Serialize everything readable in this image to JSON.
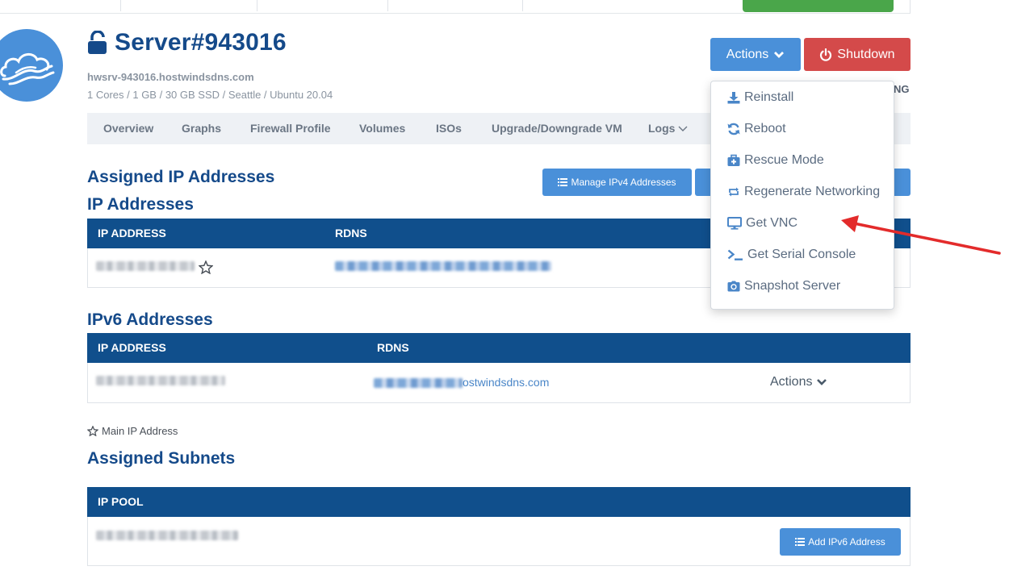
{
  "server": {
    "title": "Server#943016",
    "hostname": "hwsrv-943016.hostwindsdns.com",
    "specs": "1 Cores / 1 GB / 30 GB SSD / Seattle / Ubuntu 20.04",
    "status_fragment": "NG"
  },
  "header_buttons": {
    "actions_label": "Actions",
    "shutdown_label": "Shutdown"
  },
  "tabs": [
    {
      "label": "Overview"
    },
    {
      "label": "Graphs"
    },
    {
      "label": "Firewall Profile"
    },
    {
      "label": "Volumes"
    },
    {
      "label": "ISOs"
    },
    {
      "label": "Upgrade/Downgrade VM"
    },
    {
      "label": "Logs"
    }
  ],
  "assigned_ip": {
    "heading": "Assigned IP Addresses",
    "manage_ipv4_label": "Manage IPv4 Addresses"
  },
  "ipv4": {
    "heading": "IP Addresses",
    "columns": [
      "IP ADDRESS",
      "RDNS"
    ]
  },
  "ipv6": {
    "heading": "IPv6 Addresses",
    "columns": [
      "IP ADDRESS",
      "RDNS"
    ],
    "rdns_visible": "ostwindsdns.com",
    "row_actions_label": "Actions"
  },
  "main_ip_note": "Main IP Address",
  "subnets": {
    "heading": "Assigned Subnets",
    "columns": [
      "IP POOL"
    ],
    "add_ipv6_label": "Add IPv6 Address"
  },
  "dropdown": {
    "items": [
      {
        "label": "Reinstall",
        "icon": "download-icon"
      },
      {
        "label": "Reboot",
        "icon": "refresh-icon"
      },
      {
        "label": "Rescue Mode",
        "icon": "medkit-icon"
      },
      {
        "label": "Regenerate Networking",
        "icon": "retweet-icon"
      },
      {
        "label": "Get VNC",
        "icon": "monitor-icon"
      },
      {
        "label": "Get Serial Console",
        "icon": "terminal-icon"
      },
      {
        "label": "Snapshot Server",
        "icon": "camera-icon"
      }
    ]
  },
  "colors": {
    "brand_blue": "#154a8a",
    "button_blue": "#4a90d9",
    "table_header": "#104f8c",
    "danger": "#d44a4a",
    "success": "#4aa64a",
    "annotation_arrow": "#e32b2b"
  }
}
